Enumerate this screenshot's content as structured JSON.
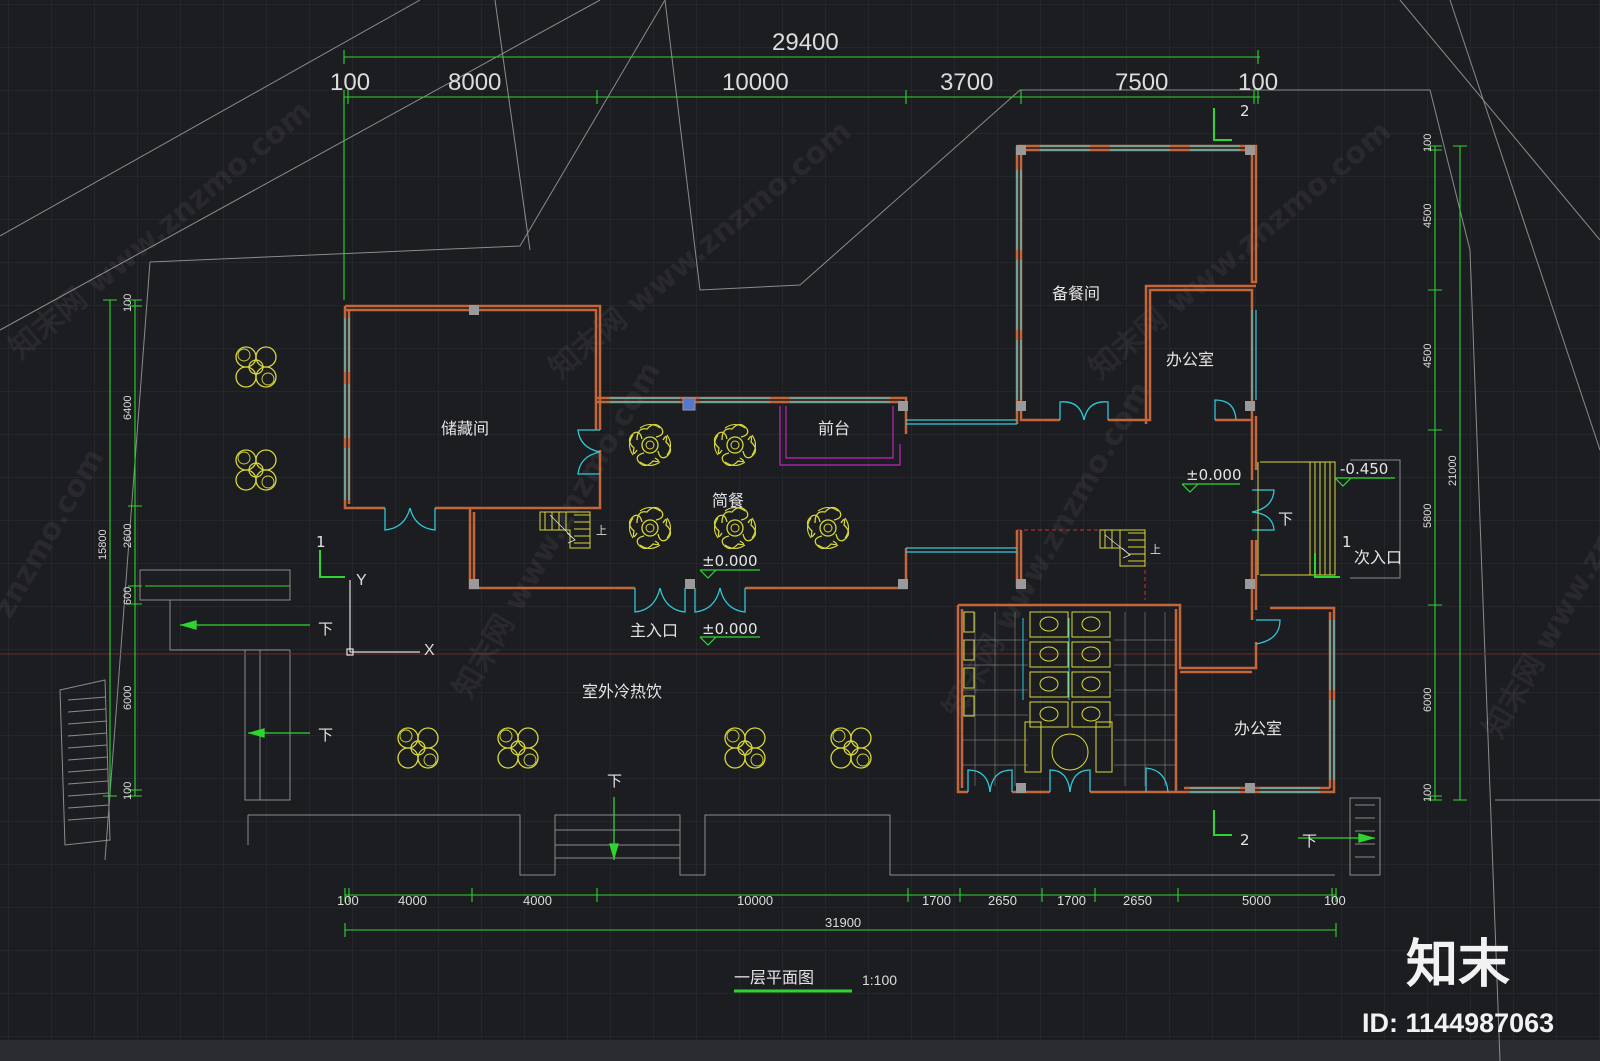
{
  "drawing": {
    "title": "一层平面图",
    "scale": "1:100"
  },
  "dimensions": {
    "top_total": "29400",
    "top_segments": [
      "100",
      "8000",
      "10000",
      "3700",
      "7500",
      "100"
    ],
    "bottom_segments": [
      "100",
      "4000",
      "4000",
      "10000",
      "1700",
      "2650",
      "1700",
      "2650",
      "5000",
      "100"
    ],
    "bottom_total": "31900",
    "left_segments": [
      "100",
      "6400",
      "2600",
      "600",
      "6000",
      "100"
    ],
    "left_total": "15800",
    "right_segments": [
      "100",
      "4500",
      "4500",
      "5800",
      "6000",
      "100"
    ],
    "right_total": "21000"
  },
  "rooms": {
    "storage": "储藏间",
    "front_desk": "前台",
    "dining": "简餐",
    "prep_room": "备餐间",
    "office_upper": "办公室",
    "office_lower": "办公室",
    "outdoor_drinks": "室外冷热饮"
  },
  "labels": {
    "main_entrance": "主入口",
    "secondary_entrance": "次入口",
    "level_dining": "±0.000",
    "level_entrance": "±0.000",
    "level_corridor": "±0.000",
    "level_ramp": "-0.450",
    "down": "下",
    "up": "上",
    "axis_x": "X",
    "axis_y": "Y",
    "section_1": "1",
    "section_2": "2"
  },
  "watermark": {
    "brand": "知末",
    "site": "znzmo.com",
    "site_full": "知末网 www.znzmo.com",
    "image_id": "ID: 1144987063"
  },
  "colors": {
    "background": "#1c1d21",
    "grid": "#2d3036",
    "wall": "#c4663a",
    "window": "#3ac8d8",
    "dimension": "#2fd52f",
    "furniture": "#d8d83a",
    "door": "#2fc8d8",
    "counter": "#c026c0",
    "column": "#9a9a9a",
    "text": "#e4e4e4"
  }
}
